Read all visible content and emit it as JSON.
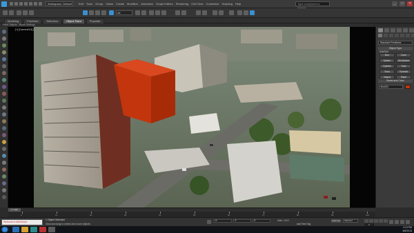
{
  "titlebar": {
    "workspace": "Workspace: Default",
    "search_placeholder": "Type a keyword or phrase",
    "menu": [
      "Edit",
      "Tools",
      "Group",
      "Views",
      "Create",
      "Modifiers",
      "Animation",
      "Graph Editors",
      "Rendering",
      "Civil View",
      "Customize",
      "Scripting",
      "Help"
    ],
    "minimize": "_",
    "maximize": "□",
    "close": "✕"
  },
  "toolbar": {
    "selection_filter": "All"
  },
  "ribbon": {
    "tabs": [
      "Modeling",
      "Freeform",
      "Selection",
      "Object Paint",
      "Populate"
    ],
    "active_tab": "Object Paint",
    "sub_label": "Paint Objects · Brush Settings"
  },
  "viewport": {
    "label": "[+] [Camera001] [Realistic]"
  },
  "command_panel": {
    "dropdown": "Standard Primitives",
    "object_type_label": "Object Type",
    "autogrid_label": "AutoGrid",
    "buttons": [
      "Box",
      "Cone",
      "Sphere",
      "GeoSphere",
      "Cylinder",
      "Tube",
      "Torus",
      "Pyramid",
      "Teapot",
      "Plane"
    ],
    "name_color_label": "Name and Color",
    "object_name": "Box001",
    "object_color": "#c3350d"
  },
  "timeline": {
    "slider_label": "0 / 100",
    "ticks": [
      "0",
      "10",
      "20",
      "30",
      "40",
      "50",
      "60",
      "70",
      "80",
      "90",
      "100"
    ]
  },
  "statusbar": {
    "maxscript": "Welcome to MAXScript.",
    "selection_status": "1 Object Selected",
    "prompt": "Click and drag to select and move objects",
    "coord_x": "X:",
    "coord_y": "Y:",
    "coord_z": "Z:",
    "grid": "Grid = 10.0",
    "add_time_tag": "Add Time Tag",
    "auto_key": "Auto Key",
    "set_key_filter": "Selected",
    "frame": "0"
  },
  "taskbar": {
    "clock_time": "2:19 PM",
    "clock_date": "4/8/2013"
  }
}
